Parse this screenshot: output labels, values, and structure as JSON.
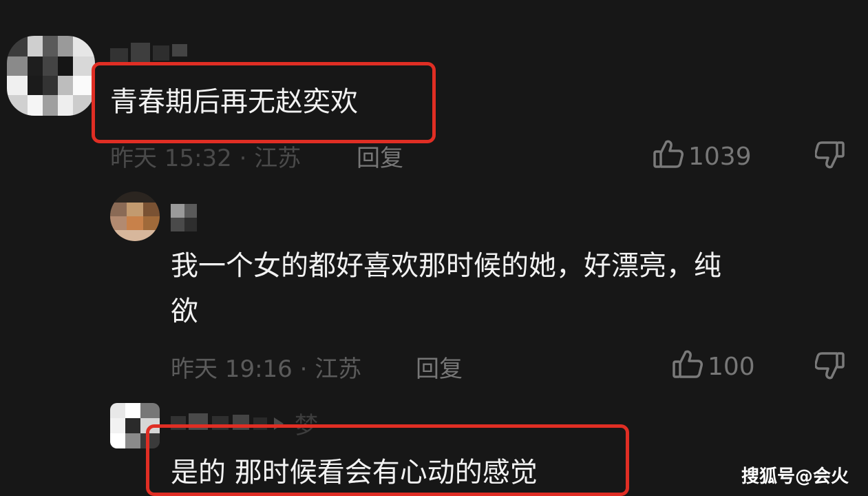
{
  "colors": {
    "background": "#171717",
    "highlight_border": "#e02e24",
    "text_primary": "#f2f2f2",
    "text_meta": "#5b5b5b"
  },
  "comments": [
    {
      "text": "青春期后再无赵奕欢",
      "meta": "昨天 15:32 · 江苏",
      "reply_label": "回复",
      "likes": "1039",
      "highlighted": true
    },
    {
      "text_line1": "我一个女的都好喜欢那时候的她，好漂亮，纯",
      "text_line2": "欲",
      "meta": "昨天 19:16 · 江苏",
      "reply_label": "回复",
      "likes": "100",
      "highlighted": false
    },
    {
      "reply_to": "梦",
      "text": "是的 那时候看会有心动的感觉",
      "highlighted": true
    }
  ],
  "icons": [
    "thumbs-up-icon",
    "thumbs-down-icon",
    "reply-arrow-icon"
  ],
  "watermark": "搜狐号@会火"
}
